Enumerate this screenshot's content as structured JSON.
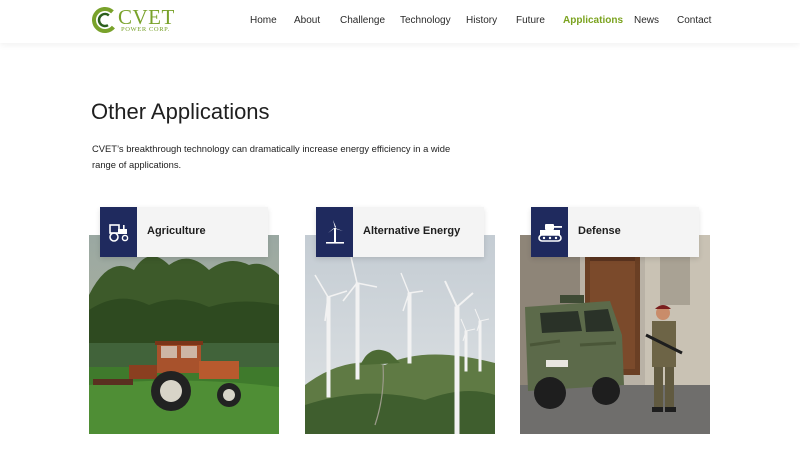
{
  "brand": {
    "name": "CVET",
    "tagline": "POWER CORP."
  },
  "nav": [
    {
      "label": "Home"
    },
    {
      "label": "About"
    },
    {
      "label": "Challenge"
    },
    {
      "label": "Technology"
    },
    {
      "label": "History"
    },
    {
      "label": "Future"
    },
    {
      "label": "Applications",
      "active": true
    },
    {
      "label": "News"
    },
    {
      "label": "Contact"
    }
  ],
  "section": {
    "title": "Other Applications",
    "intro": "CVET’s breakthrough technology can dramatically increase energy efficiency in a wide range of applications."
  },
  "cards": [
    {
      "label": "Agriculture",
      "icon": "tractor-icon"
    },
    {
      "label": "Alternative Energy",
      "icon": "wind-turbine-icon"
    },
    {
      "label": "Defense",
      "icon": "tank-icon"
    }
  ],
  "colors": {
    "accent": "#7ba31f",
    "icon_tile": "#1f2a5e",
    "label_bg": "#f4f4f4"
  }
}
